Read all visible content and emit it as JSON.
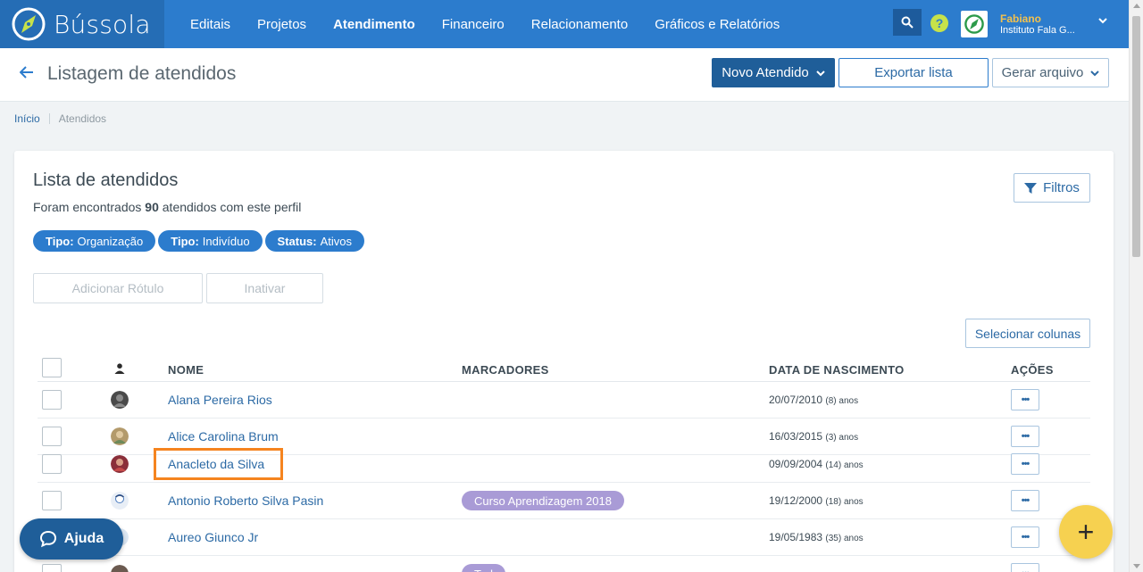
{
  "app": {
    "name": "Bússola"
  },
  "nav": {
    "items": [
      {
        "label": "Editais",
        "active": false
      },
      {
        "label": "Projetos",
        "active": false
      },
      {
        "label": "Atendimento",
        "active": true
      },
      {
        "label": "Financeiro",
        "active": false
      },
      {
        "label": "Relacionamento",
        "active": false
      },
      {
        "label": "Gráficos e Relatórios",
        "active": false
      }
    ]
  },
  "user": {
    "name": "Fabiano",
    "org": "Instituto Fala G..."
  },
  "header": {
    "title": "Listagem de atendidos",
    "new_label": "Novo Atendido",
    "export_label": "Exportar lista",
    "generate_label": "Gerar arquivo"
  },
  "breadcrumb": {
    "home": "Início",
    "current": "Atendidos"
  },
  "card": {
    "title": "Lista de atendidos",
    "sub_prefix": "Foram encontrados ",
    "count": "90",
    "sub_suffix": " atendidos com este perfil",
    "filters_label": "Filtros",
    "chips": [
      {
        "key": "Tipo:",
        "value": "Organização"
      },
      {
        "key": "Tipo:",
        "value": "Indivíduo"
      },
      {
        "key": "Status:",
        "value": "Ativos"
      }
    ],
    "add_label": "Adicionar Rótulo",
    "inactivate_label": "Inativar",
    "columns_label": "Selecionar colunas"
  },
  "table": {
    "headers": {
      "name": "NOME",
      "tags": "MARCADORES",
      "birth": "DATA DE NASCIMENTO",
      "actions": "AÇÕES"
    },
    "action_label": "•••",
    "rows": [
      {
        "name": "Alana Pereira Rios",
        "tag": "",
        "date": "20/07/2010",
        "age": "(8) anos",
        "avatar_color": "#4a4a4a"
      },
      {
        "name": "Alice Carolina Brum",
        "tag": "",
        "date": "16/03/2015",
        "age": "(3) anos",
        "avatar_color": "#b39a6b"
      },
      {
        "name": "Anacleto da Silva",
        "tag": "",
        "date": "09/09/2004",
        "age": "(14) anos",
        "avatar_color": "#8a2f3a"
      },
      {
        "name": "Antonio Roberto Silva Pasin",
        "tag": "Curso Aprendizagem 2018",
        "date": "19/12/2000",
        "age": "(18) anos",
        "avatar_color": "#e8eef6"
      },
      {
        "name": "Aureo Giunco Jr",
        "tag": "",
        "date": "19/05/1983",
        "age": "(35) anos",
        "avatar_color": "#dbe6f2"
      },
      {
        "name": "",
        "tag": "Tod",
        "date": "",
        "age": "",
        "avatar_color": "#6b5a50"
      }
    ]
  },
  "help": {
    "label": "Ajuda"
  },
  "fab": {
    "label": "+"
  },
  "colors": {
    "brand": "#2c7ccd",
    "primary_dark": "#1f5e99",
    "accent": "#f6d150",
    "tag": "#a99bd6",
    "highlight": "#f5841f"
  }
}
